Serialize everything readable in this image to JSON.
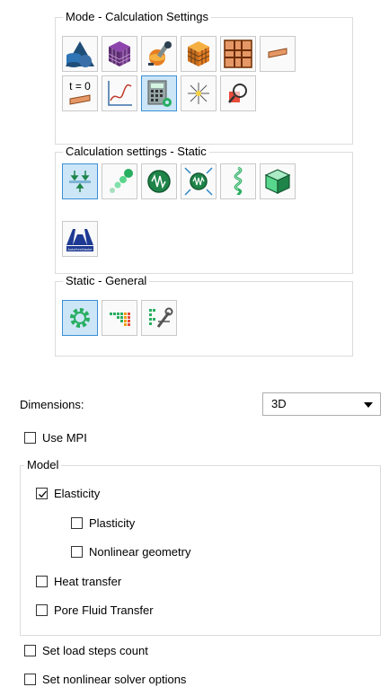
{
  "mode_group": {
    "title": "Mode - Calculation Settings"
  },
  "mode_tiles": [
    {
      "icon": "solid-shapes-icon"
    },
    {
      "icon": "mesh-cube-icon"
    },
    {
      "icon": "material-tools-icon"
    },
    {
      "icon": "block-cube-icon"
    },
    {
      "icon": "grid-icon"
    },
    {
      "icon": "beam-icon"
    },
    {
      "icon": "initial-state-icon",
      "text": "t = 0"
    },
    {
      "icon": "graph-icon"
    },
    {
      "icon": "calculator-settings-icon",
      "active": true
    },
    {
      "icon": "sparkle-icon"
    },
    {
      "icon": "magnifier-icon"
    }
  ],
  "calc_group": {
    "title": "Calculation settings - Static"
  },
  "calc_tiles": [
    {
      "icon": "static-load-icon",
      "active": true
    },
    {
      "icon": "dynamic-icon"
    },
    {
      "icon": "vibration-icon"
    },
    {
      "icon": "seismic-icon"
    },
    {
      "icon": "spring-icon"
    },
    {
      "icon": "soil-box-icon"
    },
    {
      "icon": "autocad-logo-icon",
      "text": "AutoHexMaster"
    }
  ],
  "static_group": {
    "title": "Static - General"
  },
  "static_tiles": [
    {
      "icon": "gear-icon",
      "active": true
    },
    {
      "icon": "color-steps-icon"
    },
    {
      "icon": "solver-options-icon"
    }
  ],
  "dimensions": {
    "label": "Dimensions:",
    "value": "3D"
  },
  "use_mpi": {
    "label": "Use MPI",
    "checked": false
  },
  "model": {
    "title": "Model",
    "elasticity": {
      "label": "Elasticity",
      "checked": true
    },
    "plasticity": {
      "label": "Plasticity",
      "checked": false
    },
    "nonlinear_geometry": {
      "label": "Nonlinear geometry",
      "checked": false
    },
    "heat_transfer": {
      "label": "Heat transfer",
      "checked": false
    },
    "pore_fluid": {
      "label": "Pore Fluid Transfer",
      "checked": false
    }
  },
  "load_steps": {
    "label": "Set load steps count",
    "checked": false
  },
  "nonlinear_solver": {
    "label": "Set nonlinear solver options",
    "checked": false
  },
  "colors": {
    "accent": "#3a8fd6",
    "active_bg": "#cce6f7",
    "border": "#dcdcdc"
  }
}
